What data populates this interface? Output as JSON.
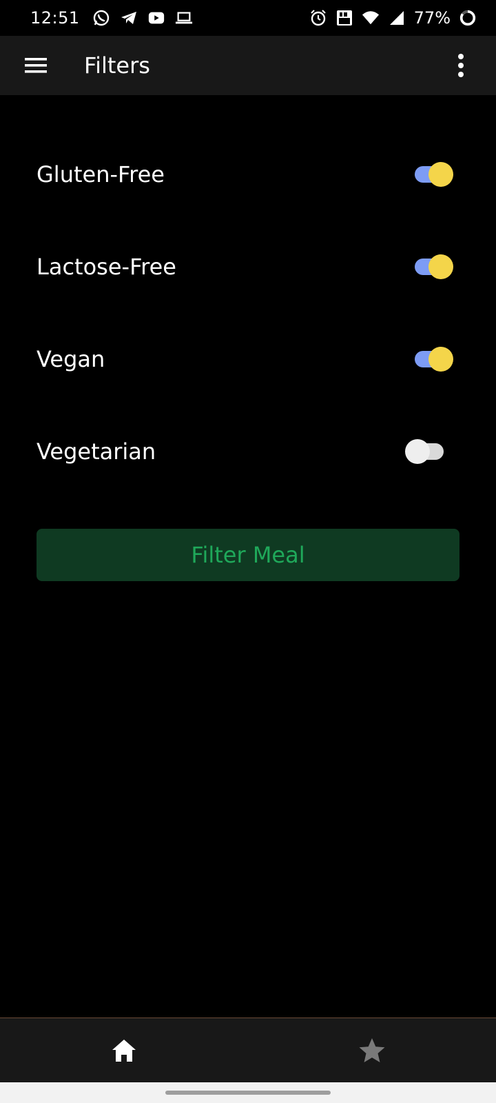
{
  "status_bar": {
    "time": "12:51",
    "battery": "77%",
    "left_icons": [
      "whatsapp-icon",
      "telegram-icon",
      "youtube-icon",
      "laptop-icon"
    ],
    "right_icons": [
      "alarm-icon",
      "volte-icon",
      "wifi-icon",
      "signal-icon",
      "battery-ring-icon"
    ]
  },
  "app_bar": {
    "title": "Filters",
    "menu_icon": "hamburger-menu-icon",
    "more_icon": "more-vertical-icon"
  },
  "filters": [
    {
      "label": "Gluten-Free",
      "enabled": true
    },
    {
      "label": "Lactose-Free",
      "enabled": true
    },
    {
      "label": "Vegan",
      "enabled": true
    },
    {
      "label": "Vegetarian",
      "enabled": false
    }
  ],
  "filter_button": {
    "label": "Filter Meal"
  },
  "bottom_nav": {
    "items": [
      {
        "icon": "home-icon",
        "active": true
      },
      {
        "icon": "star-icon",
        "active": false
      }
    ]
  },
  "colors": {
    "background": "#000000",
    "app_bar": "#181818",
    "switch_track_on": "#7d9cf5",
    "switch_thumb_on": "#f4d54a",
    "switch_off": "#eeeeee",
    "button_bg": "#0f3a22",
    "button_text": "#1fa85a"
  }
}
